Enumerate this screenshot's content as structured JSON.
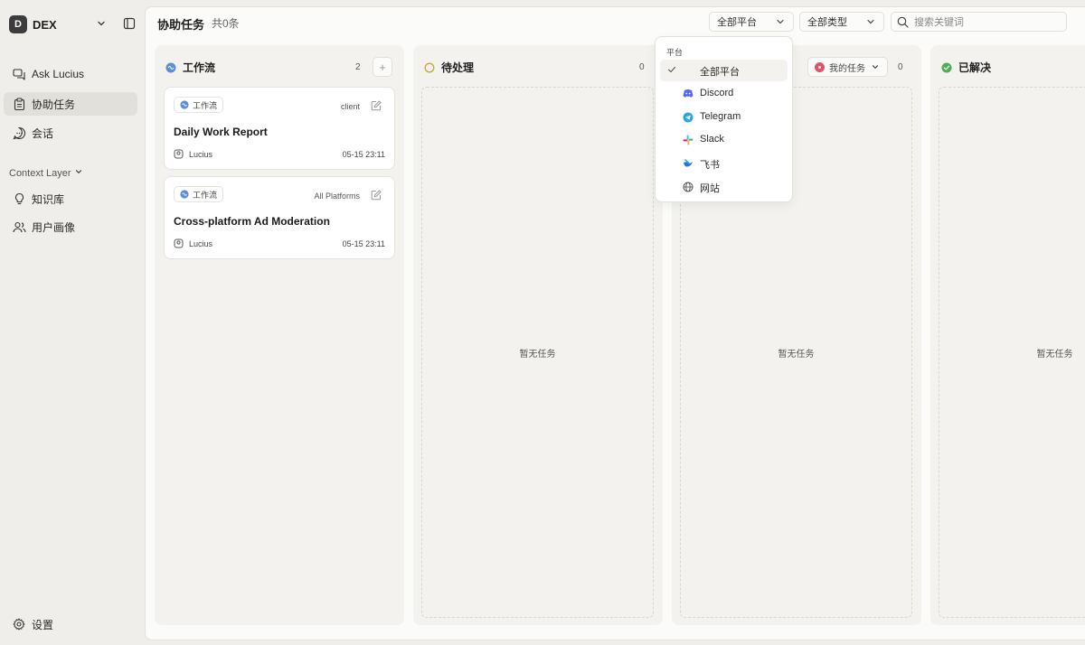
{
  "workspace": {
    "initial": "D",
    "name": "DEX"
  },
  "nav": {
    "ask": "Ask Lucius",
    "tasks": "协助任务",
    "sessions": "会话",
    "context_layer": "Context Layer",
    "knowledge": "知识库",
    "profile": "用户画像",
    "settings": "设置"
  },
  "header": {
    "title": "协助任务",
    "count": "共0条",
    "platform_filter": "全部平台",
    "type_filter": "全部类型",
    "search_placeholder": "搜索关键词"
  },
  "columns": [
    {
      "title": "工作流",
      "count": "2",
      "empty": ""
    },
    {
      "title": "待处理",
      "count": "0",
      "empty": "暂无任务"
    },
    {
      "title": "",
      "count": "0",
      "empty": "暂无任务",
      "filter": "我的任务"
    },
    {
      "title": "已解决",
      "count": "",
      "empty": "暂无任务"
    }
  ],
  "cards": [
    {
      "tag": "工作流",
      "source": "client",
      "title": "Daily Work Report",
      "user": "Lucius",
      "time": "05-15 23:11"
    },
    {
      "tag": "工作流",
      "source": "All Platforms",
      "title": "Cross-platform Ad Moderation",
      "user": "Lucius",
      "time": "05-15 23:11"
    }
  ],
  "platform_dropdown": {
    "heading": "平台",
    "items": [
      {
        "label": "全部平台",
        "icon": "check-icon",
        "selected": true
      },
      {
        "label": "Discord",
        "icon": "discord-icon",
        "color": "#5865f2"
      },
      {
        "label": "Telegram",
        "icon": "telegram-icon",
        "color": "#2aa3df"
      },
      {
        "label": "Slack",
        "icon": "slack-icon"
      },
      {
        "label": "飞书",
        "icon": "feishu-icon",
        "color": "#2e6bf0"
      },
      {
        "label": "网站",
        "icon": "globe-icon"
      }
    ]
  }
}
